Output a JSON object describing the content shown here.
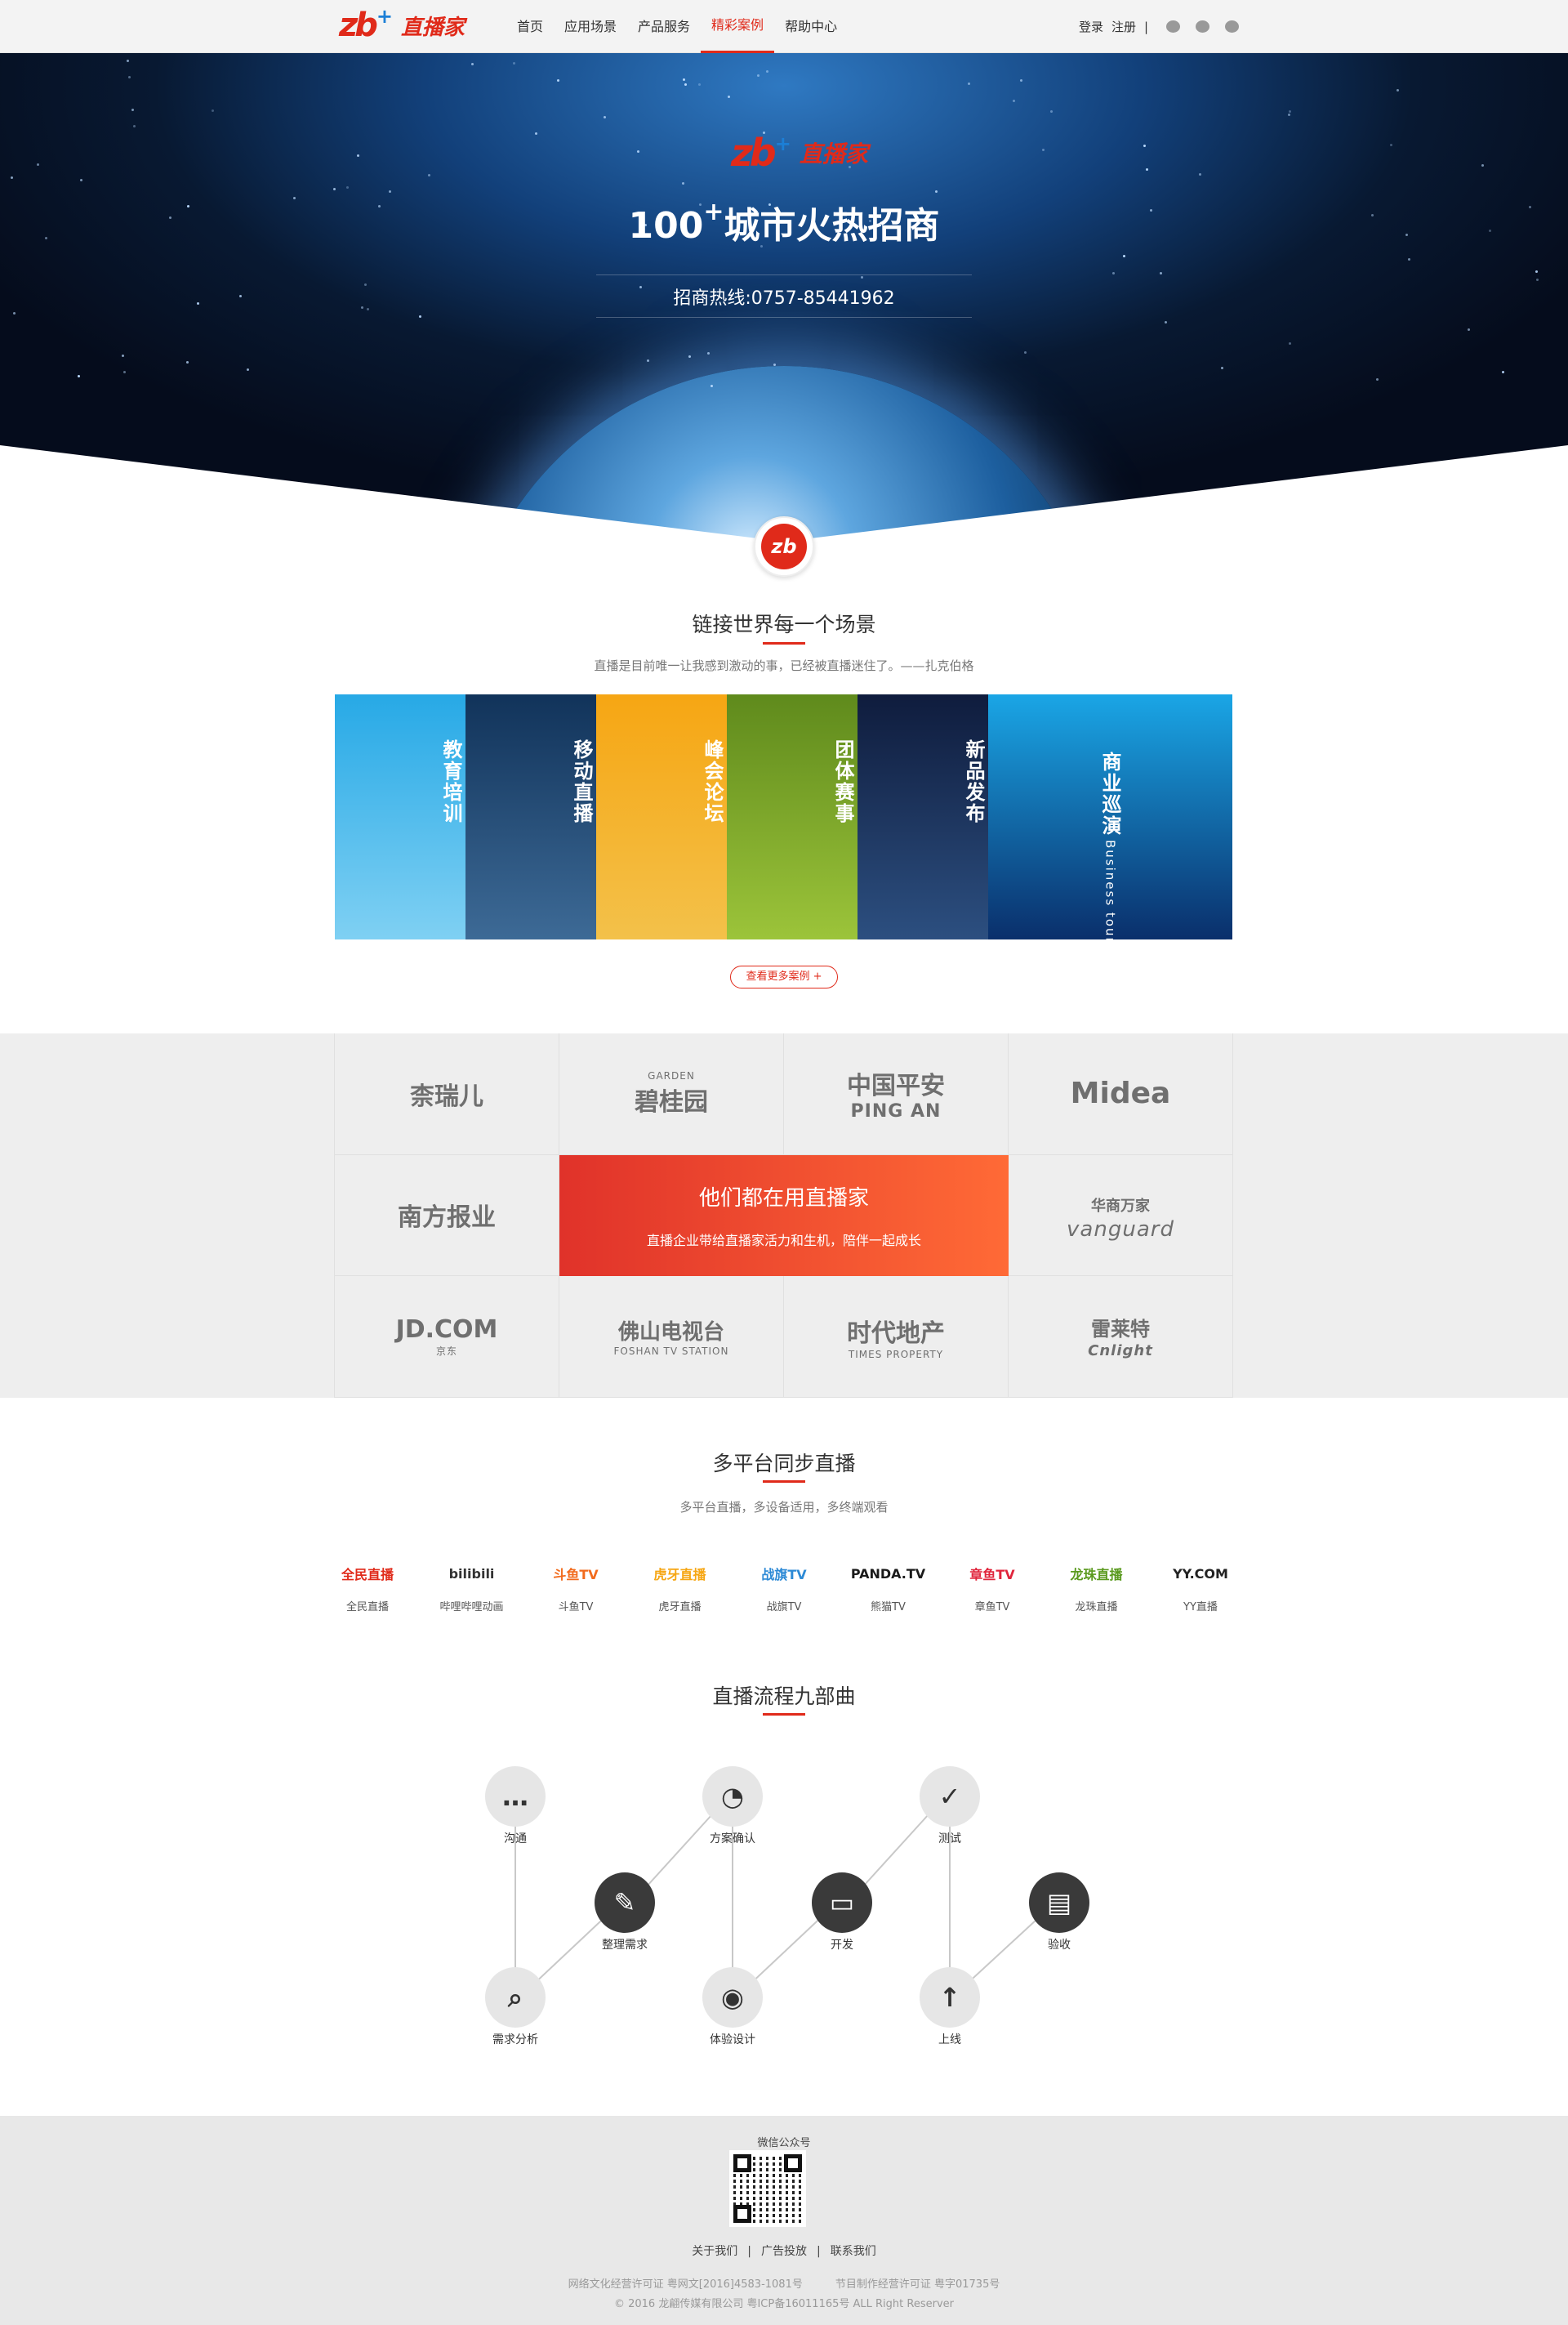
{
  "brand": {
    "mark": "zb",
    "plus": "+",
    "name": "直播家"
  },
  "nav": [
    {
      "label": "首页"
    },
    {
      "label": "应用场景"
    },
    {
      "label": "产品服务"
    },
    {
      "label": "精彩案例"
    },
    {
      "label": "帮助中心"
    }
  ],
  "nav_active": "精彩案例",
  "auth": {
    "login": "登录",
    "register": "注册",
    "sep": "|"
  },
  "social_icons": [
    "wechat-icon",
    "qq-icon",
    "weibo-icon"
  ],
  "hero": {
    "title_num": "100",
    "title_sup": "+",
    "title_text": "城市火热招商",
    "hotline": "招商热线:0757-85441962"
  },
  "scenes": {
    "title": "链接世界每一个场景",
    "quote": "直播是目前唯一让我感到激动的事，已经被直播迷住了。——扎克伯格",
    "tiles": [
      {
        "label": "教育培训",
        "colors": [
          "#27a9e6",
          "#7fd0f3"
        ]
      },
      {
        "label": "移动直播",
        "colors": [
          "#11335a",
          "#3d6a96"
        ]
      },
      {
        "label": "峰会论坛",
        "colors": [
          "#f6a613",
          "#f3c14a"
        ]
      },
      {
        "label": "团体赛事",
        "colors": [
          "#5f8a1c",
          "#9cc43a"
        ]
      },
      {
        "label": "新品发布",
        "colors": [
          "#0f1c3d",
          "#2c4f80"
        ]
      },
      {
        "label": "商业巡演",
        "sub": "Business tour",
        "colors": [
          "#1aa6e6",
          "#0a2f6b"
        ]
      }
    ],
    "more_button": "查看更多案例 +"
  },
  "partners": {
    "feature_title": "他们都在用直播家",
    "feature_sub": "直播企业带给直播家活力和生机，陪伴一起成长",
    "logos": [
      {
        "name": "柰瑞儿"
      },
      {
        "name": "碧桂园",
        "small": "GARDEN"
      },
      {
        "name": "中国平安",
        "small": "PING AN"
      },
      {
        "name": "Midea"
      },
      {
        "name": "南方报业"
      },
      {
        "name": "华商万家",
        "small": "vanguard"
      },
      {
        "name": "JD.COM",
        "small": "京东"
      },
      {
        "name": "佛山电视台",
        "small": "FOSHAN TV STATION"
      },
      {
        "name": "时代地产",
        "small": "TIMES PROPERTY"
      },
      {
        "name": "雷莱特",
        "small": "Cnlight"
      }
    ]
  },
  "platforms": {
    "title": "多平台同步直播",
    "sub": "多平台直播，多设备适用，多终端观看",
    "items": [
      {
        "logo": "全民直播",
        "name": "全民直播",
        "color": "#e02a1a"
      },
      {
        "logo": "bilibili",
        "name": "哔哩哔哩动画",
        "color": "#333333"
      },
      {
        "logo": "斗鱼TV",
        "name": "斗鱼TV",
        "color": "#f26b1d"
      },
      {
        "logo": "虎牙直播",
        "name": "虎牙直播",
        "color": "#f6a613"
      },
      {
        "logo": "战旗TV",
        "name": "战旗TV",
        "color": "#2d8ad6"
      },
      {
        "logo": "PANDA.TV",
        "name": "熊猫TV",
        "color": "#1a1a1a"
      },
      {
        "logo": "章鱼TV",
        "name": "章鱼TV",
        "color": "#e0253c"
      },
      {
        "logo": "龙珠直播",
        "name": "龙珠直播",
        "color": "#5a9a1e"
      },
      {
        "logo": "YY.COM",
        "name": "YY直播",
        "color": "#222222"
      }
    ]
  },
  "process": {
    "title": "直播流程九部曲",
    "steps": [
      {
        "label": "沟通",
        "glyph": "…"
      },
      {
        "label": "整理需求",
        "glyph": "✎"
      },
      {
        "label": "需求分析",
        "glyph": "⌕"
      },
      {
        "label": "方案确认",
        "glyph": "◔"
      },
      {
        "label": "开发",
        "glyph": "▭"
      },
      {
        "label": "体验设计",
        "glyph": "◉"
      },
      {
        "label": "测试",
        "glyph": "✓"
      },
      {
        "label": "验收",
        "glyph": "▤"
      },
      {
        "label": "上线",
        "glyph": "↑"
      }
    ]
  },
  "footer": {
    "wechat_label": "微信公众号",
    "links": [
      "关于我们",
      "广告投放",
      "联系我们"
    ],
    "link_sep": "|",
    "license1": "网络文化经营许可证 粤网文[2016]4583-1081号",
    "license2": "节目制作经营许可证 粤字01735号",
    "copyright": "© 2016 龙翩传媒有限公司 粤ICP备16011165号 ALL Right Reserver"
  }
}
